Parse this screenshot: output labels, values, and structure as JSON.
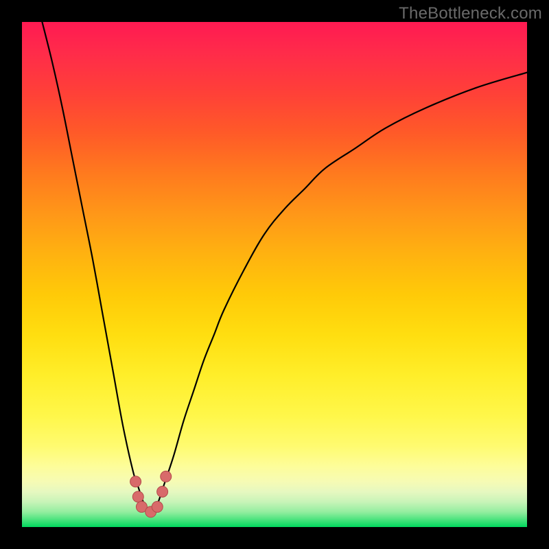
{
  "watermark": {
    "text": "TheBottleneck.com"
  },
  "colors": {
    "curve": "#000000",
    "marker_fill": "#d86a6a",
    "marker_stroke": "#b24a4a"
  },
  "chart_data": {
    "type": "line",
    "title": "",
    "xlabel": "",
    "ylabel": "",
    "xlim": [
      0,
      100
    ],
    "ylim": [
      0,
      100
    ],
    "grid": false,
    "legend": false,
    "series": [
      {
        "name": "bottleneck-curve",
        "x_values": [
          4,
          6,
          8,
          10,
          12,
          14,
          16,
          18,
          20,
          22,
          23,
          24,
          25,
          26,
          27,
          28,
          30,
          32,
          34,
          36,
          38,
          40,
          44,
          48,
          52,
          56,
          60,
          66,
          72,
          80,
          90,
          100
        ],
        "y_values": [
          100,
          92,
          83,
          73,
          63,
          53,
          42,
          31,
          20,
          11,
          8,
          5,
          3,
          3,
          5,
          8,
          14,
          21,
          27,
          33,
          38,
          43,
          51,
          58,
          63,
          67,
          71,
          75,
          79,
          83,
          87,
          90
        ]
      }
    ],
    "markers": [
      {
        "x": 22.5,
        "y": 9
      },
      {
        "x": 23.0,
        "y": 6
      },
      {
        "x": 23.7,
        "y": 4
      },
      {
        "x": 25.5,
        "y": 3
      },
      {
        "x": 26.8,
        "y": 4
      },
      {
        "x": 27.8,
        "y": 7
      },
      {
        "x": 28.5,
        "y": 10
      }
    ]
  }
}
